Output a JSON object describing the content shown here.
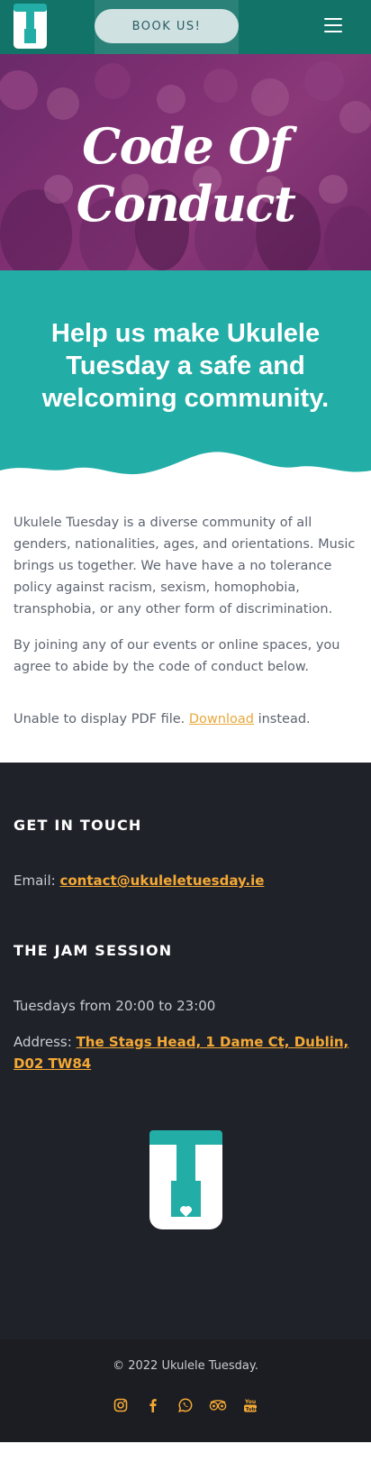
{
  "header": {
    "book_label": "BOOK US!"
  },
  "hero": {
    "title": "Code Of Conduct"
  },
  "banner": {
    "heading": "Help us make Ukulele Tuesday a safe and welcoming community."
  },
  "content": {
    "paragraph1": "Ukulele Tuesday is a diverse community of all genders, nationalities, ages, and orientations. Music brings us together. We have have a no tolerance policy against racism, sexism, homophobia, transphobia, or any other form of discrimination.",
    "paragraph2": "By joining any of our events or online spaces, you agree to abide by the code of conduct below.",
    "pdf_prefix": "Unable to display PDF file.",
    "pdf_link": "Download",
    "pdf_suffix": "instead."
  },
  "footer": {
    "contact_heading": "GET IN TOUCH",
    "email_label": "Email:",
    "email_value": "contact@ukuleletuesday.ie",
    "jam_heading": "THE JAM SESSION",
    "times": "Tuesdays from 20:00 to 23:00",
    "address_label": "Address:",
    "address_value": "The Stags Head, 1 Dame Ct, Dublin, D02 TW84",
    "copyright": "© 2022 Ukulele Tuesday.",
    "social_icons": [
      "instagram-icon",
      "facebook-icon",
      "whatsapp-icon",
      "tripadvisor-icon",
      "youtube-icon"
    ]
  },
  "colors": {
    "header_bg": "#127369",
    "teal": "#22ada7",
    "link_orange": "#f4a935",
    "footer_bg": "#20222a",
    "hero_tint": "#7e2f72"
  }
}
